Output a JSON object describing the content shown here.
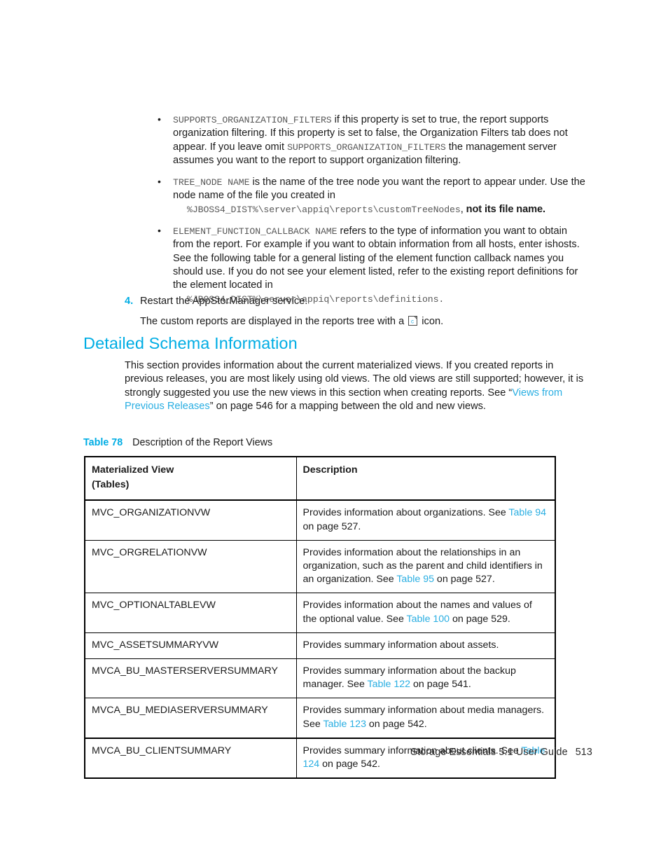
{
  "page": {
    "footer_text": "Storage Essentials 5.1 User Guide",
    "page_number": "513",
    "accent_color": "#00ADE4",
    "link_color": "#29AEE2",
    "text_color": "#1a1a1a",
    "code_color": "#585858"
  },
  "bullets": [
    {
      "code_lead": "SUPPORTS_ORGANIZATION_FILTERS",
      "text_1": " if this property is set to true, the report supports organization filtering. If this property is set to false, the Organization Filters tab does not appear. If you leave omit ",
      "code_mid": "SUPPORTS_ORGANIZATION_FILTERS",
      "text_2": " the management server assumes you want to the report to support organization filtering."
    },
    {
      "code_lead": "TREE_NODE NAME",
      "text_1": " is the name of the tree node you want the report to appear under. Use the node name of the file you created in",
      "code_path": "%JBOSS4_DIST%\\server\\appiq\\reports\\customTreeNodes",
      "path_tail_plain": ", ",
      "path_tail_bold": "not its file name."
    },
    {
      "code_lead": "ELEMENT_FUNCTION_CALLBACK NAME",
      "text_1": " refers to the type of information you want to obtain from the report. For example if you want to obtain information from all hosts, enter ishosts. See the following table for a general listing of the element function callback names you should use. If you do not see your element listed, refer to the existing report definitions for the element located in",
      "code_path": "%JBOSS4_DIST%\\server\\appiq\\reports\\definitions.",
      "path_tail_plain": "",
      "path_tail_bold": ""
    }
  ],
  "step": {
    "number": "4.",
    "label": "Restart the AppStorManager service.",
    "result_prefix": "The custom reports are displayed in the reports tree with a ",
    "icon_name": "custom-report-icon",
    "result_suffix": " icon."
  },
  "section": {
    "heading": "Detailed Schema Information",
    "intro_part1": "This section provides information about the current materialized views. If you created reports in previous releases, you are most likely using old views. The old views are still supported; however, it is strongly suggested you use the new views in this section when creating reports. See “",
    "intro_link": "Views from Previous Releases",
    "intro_part2": "” on page 546 for a mapping between the old and new views."
  },
  "table": {
    "caption_label": "Table 78",
    "caption_text": "Description of the Report Views",
    "headers": {
      "col1_line1": "Materialized View",
      "col1_line2": "(Tables)",
      "col2": "Description"
    },
    "rows": [
      {
        "view": "MVC_ORGANIZATIONVW",
        "desc_pre": "Provides information about organizations. See ",
        "desc_link": "Table 94",
        "desc_post": " on page 527."
      },
      {
        "view": "MVC_ORGRELATIONVW",
        "desc_pre": "Provides information about the relationships in an organization, such as the parent and child identifiers in an organization. See ",
        "desc_link": "Table 95",
        "desc_post": " on page 527."
      },
      {
        "view": "MVC_OPTIONALTABLEVW",
        "desc_pre": "Provides information about the names and values of the optional value. See ",
        "desc_link": "Table 100",
        "desc_post": " on page 529."
      },
      {
        "view": "MVC_ASSETSUMMARYVW",
        "desc_pre": "Provides summary information about assets.",
        "desc_link": "",
        "desc_post": ""
      },
      {
        "view": "MVCA_BU_MASTERSERVERSUMMARY",
        "desc_pre": "Provides summary information about the backup manager. See ",
        "desc_link": "Table 122",
        "desc_post": " on page 541."
      },
      {
        "view": "MVCA_BU_MEDIASERVERSUMMARY",
        "desc_pre": "Provides summary information about media managers. See ",
        "desc_link": "Table 123",
        "desc_post": " on page 542."
      },
      {
        "view": "MVCA_BU_CLIENTSUMMARY",
        "desc_pre": "Provides summary information about clients. See ",
        "desc_link": "Table 124",
        "desc_post": " on page 542."
      }
    ]
  }
}
